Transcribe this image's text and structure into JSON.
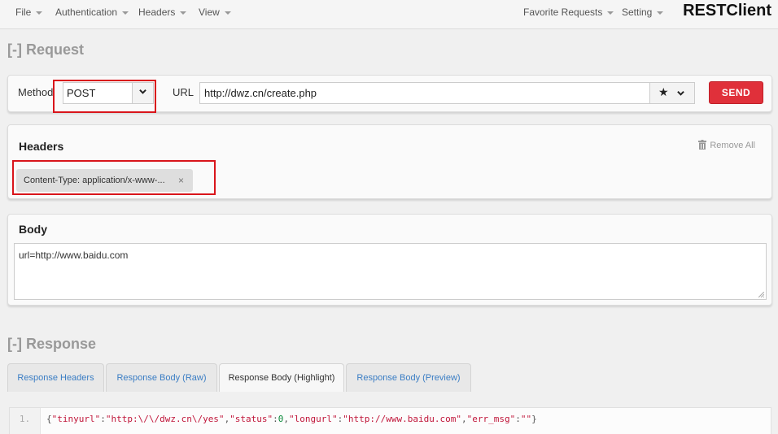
{
  "nav": {
    "menus": [
      "File",
      "Authentication",
      "Headers",
      "View"
    ],
    "right_menus": [
      "Favorite Requests",
      "Setting"
    ],
    "brand": "RESTClient"
  },
  "request": {
    "section_title": "[-] Request",
    "method_label": "Method",
    "method_value": "POST",
    "url_label": "URL",
    "url_value": "http://dwz.cn/create.php",
    "send_label": "SEND"
  },
  "headers": {
    "title": "Headers",
    "remove_all_label": "Remove All",
    "items": [
      {
        "label": "Content-Type: application/x-www-...",
        "close": "×"
      }
    ]
  },
  "body": {
    "title": "Body",
    "value": "url=http://www.baidu.com"
  },
  "response": {
    "section_title": "[-] Response",
    "tabs": [
      {
        "label": "Response Headers",
        "active": false
      },
      {
        "label": "Response Body (Raw)",
        "active": false
      },
      {
        "label": "Response Body (Highlight)",
        "active": true
      },
      {
        "label": "Response Body (Preview)",
        "active": false
      }
    ],
    "code": {
      "line_number": "1.",
      "tokens": [
        {
          "t": "{",
          "k": "punc"
        },
        {
          "t": "\"tinyurl\"",
          "k": "str"
        },
        {
          "t": ":",
          "k": "punc"
        },
        {
          "t": "\"http:\\/\\/dwz.cn\\/yes\"",
          "k": "str"
        },
        {
          "t": ",",
          "k": "punc"
        },
        {
          "t": "\"status\"",
          "k": "str"
        },
        {
          "t": ":",
          "k": "punc"
        },
        {
          "t": "0",
          "k": "num"
        },
        {
          "t": ",",
          "k": "punc"
        },
        {
          "t": "\"longurl\"",
          "k": "str"
        },
        {
          "t": ":",
          "k": "punc"
        },
        {
          "t": "\"http://www.baidu.com\"",
          "k": "str"
        },
        {
          "t": ",",
          "k": "punc"
        },
        {
          "t": "\"err_msg\"",
          "k": "str"
        },
        {
          "t": ":",
          "k": "punc"
        },
        {
          "t": "\"\"",
          "k": "str"
        },
        {
          "t": "}",
          "k": "punc"
        }
      ]
    }
  },
  "colors": {
    "send_button": "#e0303a",
    "highlight_box": "#d9151b",
    "tab_link": "#3a7dc4"
  }
}
